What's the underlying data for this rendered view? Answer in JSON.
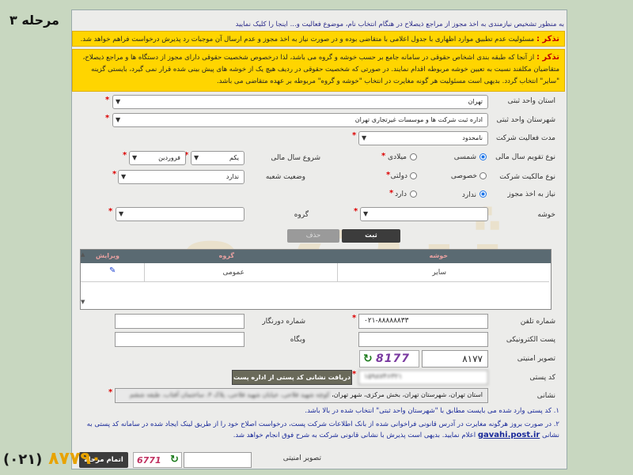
{
  "stage": "مرحله ۳",
  "notes": {
    "top_line": "به منظور تشخیص نیازمندی به اخذ مجوز از مراجع ذیصلاح در هنگام انتخاب نام، موضوع فعالیت و... اینجا را کلیک نمایید",
    "top_link": "اینجا را",
    "warn1_title": "تذکر :",
    "warn1_text": "مسئولیت عدم تطبیق موارد اظهاری با جدول اعلامی با متقاضی بوده و در صورت نیاز به اخذ مجوز و عدم ارسال آن موجبات رد پذیرش درخواست فراهم خواهد شد.",
    "warn2_title": "تذکر :",
    "warn2_text": "از آنجا که طبقه بندی اشخاص حقوقی در سامانه جامع بر حسب خوشه و گروه می باشد، لذا درخصوص شخصیت حقوقی دارای مجوز از دستگاه ها و مراجع ذیصلاح، متقاضیان مکلفند نسبت به تعیین خوشه مربوطه اقدام نمایند. در صورتی که شخصیت حقوقی در ردیف هیچ یک از خوشه های پیش بینی شده قرار نمی گیرد، بایستی گزینه \"سایر\" انتخاب گردد. بدیهی است مسئولیت هر گونه مغایرت در انتخاب \"خوشه و گروه\" مربوطه بر عهده متقاضی می باشد."
  },
  "form": {
    "province_label": "استان واحد ثبتی",
    "province_value": "تهران",
    "city_label": "شهرستان واحد ثبتی",
    "city_value": "اداره ثبت شرکت ها و موسسات غیرتجاری تهران",
    "duration_label": "مدت فعالیت شرکت",
    "duration_value": "نامحدود",
    "calendar_label": "نوع تقویم سال مالی",
    "calendar_opt1": "شمسی",
    "calendar_opt2": "میلادی",
    "fiscal_start_label": "شروع سال مالی",
    "fiscal_day": "یکم",
    "fiscal_month": "فروردین",
    "ownership_label": "نوع مالکیت شرکت",
    "ownership_opt1": "خصوصی",
    "ownership_opt2": "دولتی",
    "branch_label": "وضعیت شعبه",
    "branch_value": "ندارد",
    "license_label": "نیاز به اخذ مجوز",
    "license_opt1": "ندارد",
    "license_opt2": "دارد",
    "cluster_label": "خوشه",
    "group_label": "گروه",
    "register_btn": "ثبت",
    "delete_btn": "حذف",
    "table_headers": [
      "خوشه",
      "گروه",
      "ویرایش"
    ],
    "table_row": {
      "cluster": "سایر",
      "group": "عمومی"
    },
    "phone_label": "شماره تلفن",
    "phone_value": "۰۲۱-۸۸۸۸۸۸۳۳",
    "fax_label": "شماره دورنگار",
    "email_label": "پست الکترونیکی",
    "website_label": "وبگاه",
    "captcha_label": "تصویر امنیتی",
    "captcha_input": "۸۱۷۷",
    "captcha_image": "8177",
    "postal_label": "کد پستی",
    "postal_value": "۱۵۹۸۷۴۶۳۲۱",
    "postal_btn": "دریافت نشانی کد پستی از اداره پست",
    "address_label": "نشانی",
    "address_value": "استان تهران، شهرستان تهران، بخش مرکزی، شهر تهران،",
    "address_blurred": "کوچه شهید فلاحی، خیابان شهید فلاحی، پلاک ۴، ساختمان آفتاب، طبقه ششم",
    "footnote1": "۱. کد پستی وارد شده می بایست مطابق با \"شهرستان واحد ثبتی\" انتخاب شده در بالا باشد.",
    "footnote2": "۲. در صورت بروز هرگونه مغایرت در آدرس قانونی فراخوانی شده از بانک اطلاعات شرکت پست، درخواست اصلاح خود را از طریق لینک ایجاد شده در سامانه کد پستی به نشانی",
    "footnote2_link": "gavahi.post.ir",
    "footnote2_tail": "اعلام نمایید. بدیهی است پذیرش با نشانی قانونی شرکت به شرح فوق انجام خواهد شد.",
    "captcha2_label": "تصویر امنیتی",
    "captcha2_image": "6771",
    "submit_btn": "اتمام مرحله"
  },
  "footer_phone": {
    "number": "۸۷۷۹۰",
    "code": "(۰۲۱)"
  },
  "watermark": "ثبت و"
}
